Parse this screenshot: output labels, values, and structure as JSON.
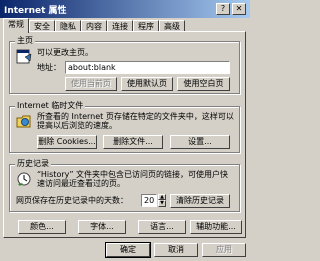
{
  "window": {
    "title": "Internet 属性"
  },
  "tabs": [
    "常规",
    "安全",
    "隐私",
    "内容",
    "连接",
    "程序",
    "高级"
  ],
  "home": {
    "legend": "主页",
    "description": "可以更改主页。",
    "address_label": "地址：",
    "address_value": "about:blank",
    "buttons": [
      "使用当前页",
      "使用默认页",
      "使用空白页"
    ]
  },
  "temp_files": {
    "legend": "Internet 临时文件",
    "description_line1": "所查看的 Internet 页存储在特定的文件夹中，这样可以",
    "description_line2": "提高以后浏览的速度。",
    "buttons": [
      "删除 Cookies...",
      "删除文件...",
      "设置..."
    ]
  },
  "history": {
    "legend": "历史记录",
    "description_line1": "“History” 文件夹中包含已访问页的链接，可使用户快",
    "description_line2": "速访问最近查看过的页。",
    "days_label": "网页保存在历史记录中的天数：",
    "days_value": "20",
    "clear_button": "清除历史记录"
  },
  "bottom_buttons": [
    "颜色...",
    "字体...",
    "语言...",
    "辅助功能..."
  ],
  "dialog_buttons": [
    "确定",
    "取消",
    "应用"
  ]
}
